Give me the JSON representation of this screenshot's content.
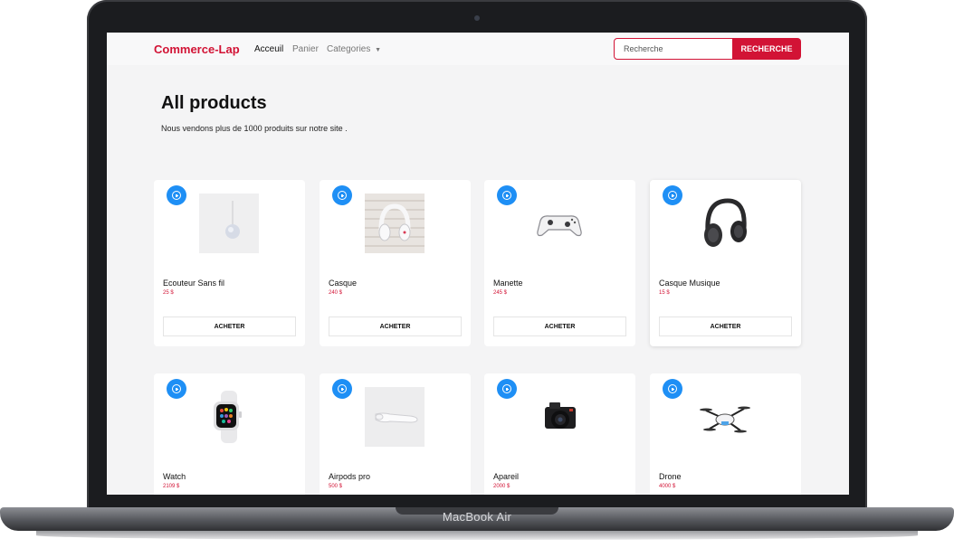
{
  "device_label": "MacBook Air",
  "colors": {
    "brand": "#d21335",
    "add_button": "#1e8ff5",
    "page_bg": "#f4f4f5"
  },
  "navbar": {
    "logo": "Commerce-Lap",
    "links": [
      "Acceuil",
      "Panier",
      "Categories"
    ],
    "search": {
      "placeholder": "Recherche",
      "button_label": "RECHERCHE"
    }
  },
  "heading": {
    "title": "All products",
    "subtitle": "Nous vendons plus de 1000 produits sur notre site ."
  },
  "products": [
    {
      "name": "Ecouteur Sans fil",
      "price": "25 $",
      "button": "ACHETER",
      "icon": "wireless-earbud-icon"
    },
    {
      "name": "Casque",
      "price": "240 $",
      "button": "ACHETER",
      "icon": "headphones-icon"
    },
    {
      "name": "Manette",
      "price": "245 $",
      "button": "ACHETER",
      "icon": "gamepad-icon"
    },
    {
      "name": "Casque Musique",
      "price": "15 $",
      "button": "ACHETER",
      "icon": "studio-headphones-icon"
    },
    {
      "name": "Watch",
      "price": "2109 $",
      "icon": "smartwatch-icon"
    },
    {
      "name": "Airpods pro",
      "price": "500 $",
      "icon": "airpods-icon"
    },
    {
      "name": "Apareil",
      "price": "2000 $",
      "icon": "camera-icon"
    },
    {
      "name": "Drone",
      "price": "4000 $",
      "icon": "drone-icon"
    }
  ]
}
